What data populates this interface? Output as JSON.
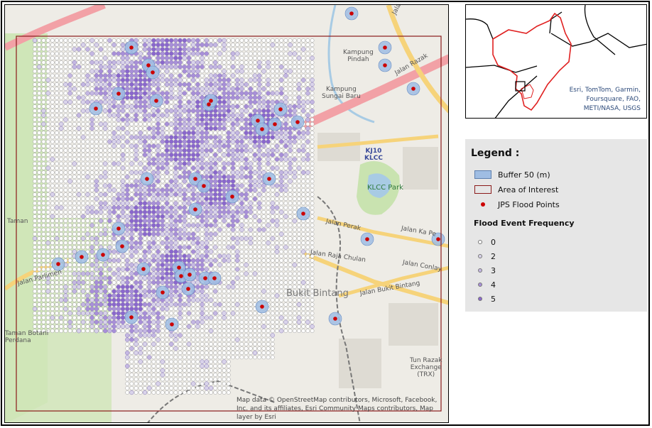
{
  "colors": {
    "buffer": "#9fbde3",
    "aoi": "#8b1a1a",
    "flood_point": "#cc0000",
    "freq": [
      "#ffffff",
      "#d9d3ea",
      "#c4b7e2",
      "#a88fd8",
      "#8a67cc"
    ],
    "road_major": "#f6d37a",
    "road_minor": "#ffffff",
    "highway": "#f2a1a6",
    "green": "#cfe6b8",
    "water": "#a8cbe4",
    "inset_boundary": "#e02020",
    "inset_lines": "#000000"
  },
  "map_labels": [
    {
      "text": "Jalan Raja Chulan",
      "kind": "road"
    },
    {
      "text": "Jalan Perak",
      "kind": "road"
    },
    {
      "text": "Jalan Ka Pe",
      "kind": "road"
    },
    {
      "text": "Jalan Conlay",
      "kind": "road"
    },
    {
      "text": "Jalan Bukit Bintang",
      "kind": "road"
    },
    {
      "text": "Jalan Parlimen",
      "kind": "road"
    },
    {
      "text": "Jalan Razak",
      "kind": "road"
    },
    {
      "text": "Jalan",
      "kind": "road"
    },
    {
      "text": "Kampung\nPindah",
      "kind": "place"
    },
    {
      "text": "Kampung\nSungai Baru",
      "kind": "place"
    },
    {
      "text": "KJ10\nKLCC",
      "kind": "station"
    },
    {
      "text": "KLCC Park",
      "kind": "park"
    },
    {
      "text": "Taman",
      "kind": "place"
    },
    {
      "text": "Taman Botani\nPerdana",
      "kind": "place"
    },
    {
      "text": "Bukit Bintang",
      "kind": "district"
    },
    {
      "text": "Tun Razak\nExchange\n(TRX)",
      "kind": "place"
    }
  ],
  "attribution": "Map data © OpenStreetMap contributors, Microsoft, Facebook, Inc. and its affiliates, Esri Community Maps contributors, Map layer by Esri",
  "inset": {
    "credit": "Esri, TomTom, Garmin, Foursquare, FAO, METI/NASA, USGS"
  },
  "legend": {
    "title": "Legend :",
    "items": [
      {
        "label": "Buffer 50 (m)",
        "icon": "buffer-swatch-icon"
      },
      {
        "label": "Area of Interest",
        "icon": "aoi-outline-icon"
      },
      {
        "label": "JPS Flood Points",
        "icon": "flood-point-icon"
      }
    ],
    "frequency_title": "Flood Event Frequency",
    "frequency_classes": [
      "0",
      "2",
      "3",
      "4",
      "5"
    ]
  }
}
